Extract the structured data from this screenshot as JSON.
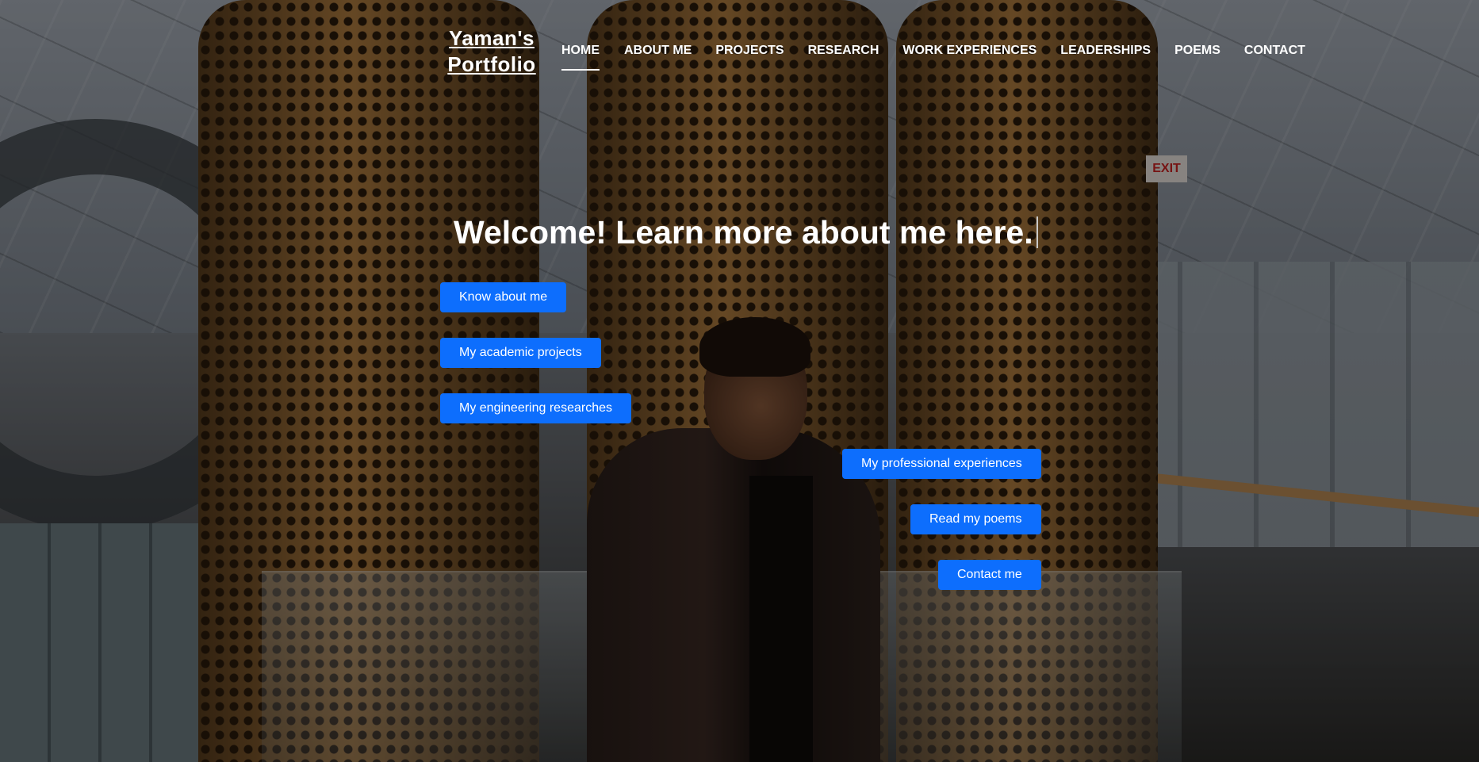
{
  "brand": {
    "line1": "Yaman's",
    "line2": "Portfolio"
  },
  "nav": {
    "items": [
      {
        "label": "HOME",
        "active": true
      },
      {
        "label": "ABOUT ME"
      },
      {
        "label": "PROJECTS"
      },
      {
        "label": "RESEARCH"
      },
      {
        "label": "WORK EXPERIENCES"
      },
      {
        "label": "LEADERSHIPS"
      },
      {
        "label": "POEMS"
      },
      {
        "label": "CONTACT"
      }
    ]
  },
  "hero": {
    "heading": "Welcome! Learn more about me here.",
    "buttons": {
      "know_about_me": "Know about me",
      "academic_projects": "My academic projects",
      "engineering_researches": "My engineering researches",
      "professional_experiences": "My professional experiences",
      "read_poems": "Read my poems",
      "contact_me": "Contact me"
    }
  },
  "background": {
    "exit_sign": "EXIT"
  },
  "colors": {
    "button": "#0d6efd",
    "text": "#ffffff"
  }
}
